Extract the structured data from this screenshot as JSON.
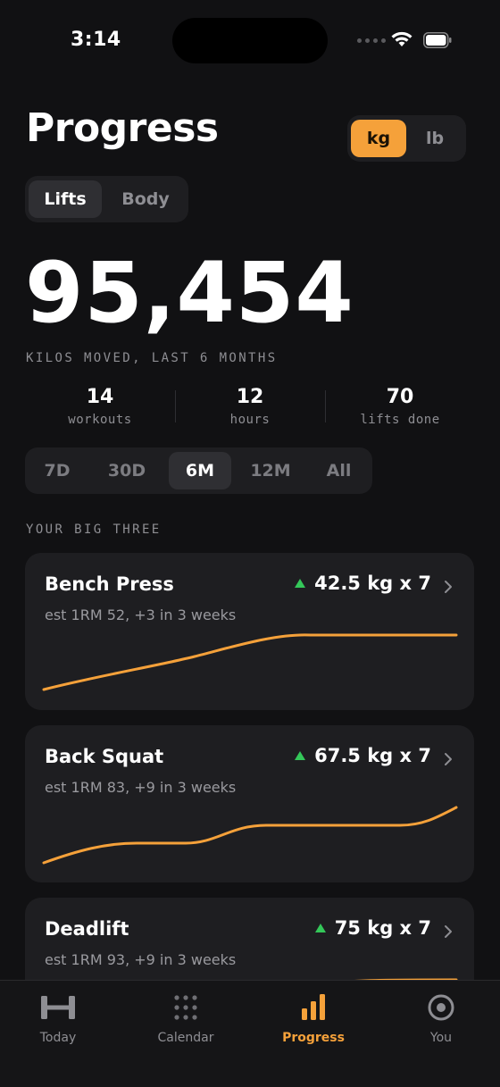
{
  "status_bar": {
    "time": "3:14"
  },
  "header": {
    "title": "Progress",
    "unit_toggle": {
      "options": [
        "kg",
        "lb"
      ],
      "selected": "kg"
    },
    "mode_toggle": {
      "options": [
        "Lifts",
        "Body"
      ],
      "selected": "Lifts"
    }
  },
  "summary": {
    "total": "95,454",
    "caption": "KILOS MOVED, LAST 6 MONTHS",
    "stats": [
      {
        "value": "14",
        "label": "workouts"
      },
      {
        "value": "12",
        "label": "hours"
      },
      {
        "value": "70",
        "label": "lifts done"
      }
    ]
  },
  "range_toggle": {
    "options": [
      "7D",
      "30D",
      "6M",
      "12M",
      "All"
    ],
    "selected": "6M"
  },
  "big_three": {
    "label": "YOUR BIG THREE",
    "lifts": [
      {
        "name": "Bench Press",
        "best": "42.5 kg x 7",
        "subtitle": "est 1RM 52, +3 in 3 weeks",
        "trend": "up"
      },
      {
        "name": "Back Squat",
        "best": "67.5 kg x 7",
        "subtitle": "est 1RM 83, +9 in 3 weeks",
        "trend": "up"
      },
      {
        "name": "Deadlift",
        "best": "75 kg x 7",
        "subtitle": "est 1RM 93, +9 in 3 weeks",
        "trend": "up"
      }
    ]
  },
  "tab_bar": {
    "tabs": [
      {
        "label": "Today",
        "icon": "barbell-icon"
      },
      {
        "label": "Calendar",
        "icon": "calendar-grid-icon"
      },
      {
        "label": "Progress",
        "icon": "bar-chart-icon"
      },
      {
        "label": "You",
        "icon": "profile-circle-icon"
      }
    ],
    "selected": "Progress"
  },
  "colors": {
    "background": "#111113",
    "card": "#1e1e21",
    "accent": "#f5a13a",
    "trend_up": "#34c759",
    "muted_text": "#8e8e93"
  }
}
